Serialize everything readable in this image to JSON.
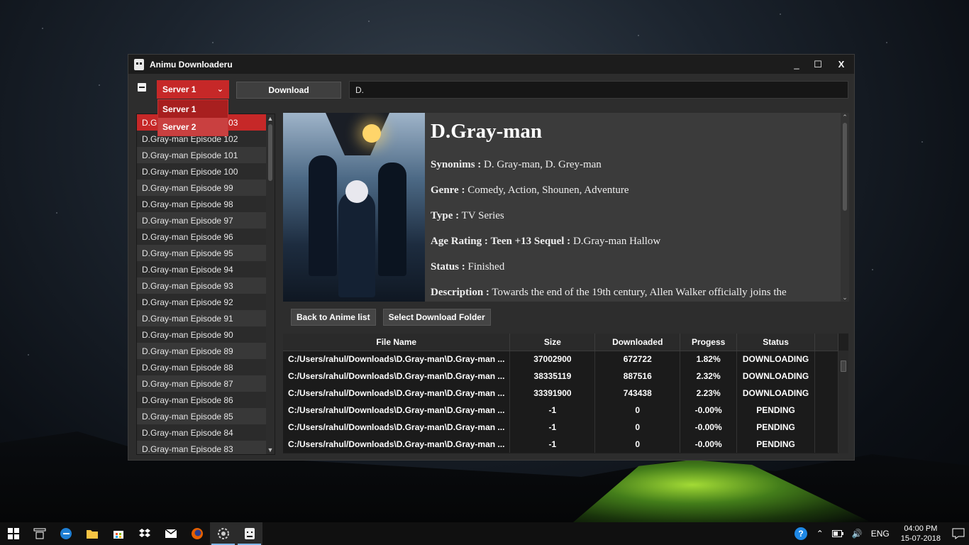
{
  "window": {
    "title": "Animu Downloaderu",
    "controls": {
      "minimize": "_",
      "maximize": "☐",
      "close": "X"
    }
  },
  "toolbar": {
    "server_selected": "Server 1",
    "server_options": [
      "Server 1",
      "Server 2"
    ],
    "download_label": "Download",
    "search_value": "D."
  },
  "episodes": [
    "D.Gray-man Episode 103",
    "D.Gray-man Episode 102",
    "D.Gray-man Episode 101",
    "D.Gray-man Episode 100",
    "D.Gray-man Episode 99",
    "D.Gray-man Episode 98",
    "D.Gray-man Episode 97",
    "D.Gray-man Episode 96",
    "D.Gray-man Episode 95",
    "D.Gray-man Episode 94",
    "D.Gray-man Episode 93",
    "D.Gray-man Episode 92",
    "D.Gray-man Episode 91",
    "D.Gray-man Episode 90",
    "D.Gray-man Episode 89",
    "D.Gray-man Episode 88",
    "D.Gray-man Episode 87",
    "D.Gray-man Episode 86",
    "D.Gray-man Episode 85",
    "D.Gray-man Episode 84",
    "D.Gray-man Episode 83"
  ],
  "details": {
    "title": "D.Gray-man",
    "synonyms_label": "Synonims :",
    "synonyms": "D. Gray-man, D. Grey-man",
    "genre_label": "Genre :",
    "genre": "Comedy, Action, Shounen, Adventure",
    "type_label": "Type :",
    "type": "TV Series",
    "age_label": "Age Rating :",
    "age": "Teen +13",
    "sequel_label": "Sequel :",
    "sequel": "D.Gray-man Hallow",
    "status_label": "Status :",
    "status": "Finished",
    "description_label": "Description :",
    "description": "Towards the end of the 19th century, Allen Walker officially joins the"
  },
  "actions": {
    "back_label": "Back to Anime list",
    "folder_label": "Select Download Folder"
  },
  "downloads": {
    "headers": [
      "File Name",
      "Size",
      "Downloaded",
      "Progess",
      "Status"
    ],
    "rows": [
      [
        "C:/Users/rahul/Downloads\\D.Gray-man\\D.Gray-man ...",
        "37002900",
        "672722",
        "1.82%",
        "DOWNLOADING"
      ],
      [
        "C:/Users/rahul/Downloads\\D.Gray-man\\D.Gray-man ...",
        "38335119",
        "887516",
        "2.32%",
        "DOWNLOADING"
      ],
      [
        "C:/Users/rahul/Downloads\\D.Gray-man\\D.Gray-man ...",
        "33391900",
        "743438",
        "2.23%",
        "DOWNLOADING"
      ],
      [
        "C:/Users/rahul/Downloads\\D.Gray-man\\D.Gray-man ...",
        "-1",
        "0",
        "-0.00%",
        "PENDING"
      ],
      [
        "C:/Users/rahul/Downloads\\D.Gray-man\\D.Gray-man ...",
        "-1",
        "0",
        "-0.00%",
        "PENDING"
      ],
      [
        "C:/Users/rahul/Downloads\\D.Gray-man\\D.Gray-man ...",
        "-1",
        "0",
        "-0.00%",
        "PENDING"
      ]
    ]
  },
  "taskbar": {
    "icons": [
      "windows-start-icon",
      "task-view-icon",
      "edge-icon",
      "file-explorer-icon",
      "store-icon",
      "dropbox-icon",
      "mail-icon",
      "firefox-icon",
      "settings-app-icon",
      "animu-downloaderu-icon"
    ],
    "language": "ENG",
    "time": "04:00 PM",
    "date": "15-07-2018"
  },
  "colors": {
    "accent": "#c62828",
    "window_bg": "#2d2d2d"
  }
}
